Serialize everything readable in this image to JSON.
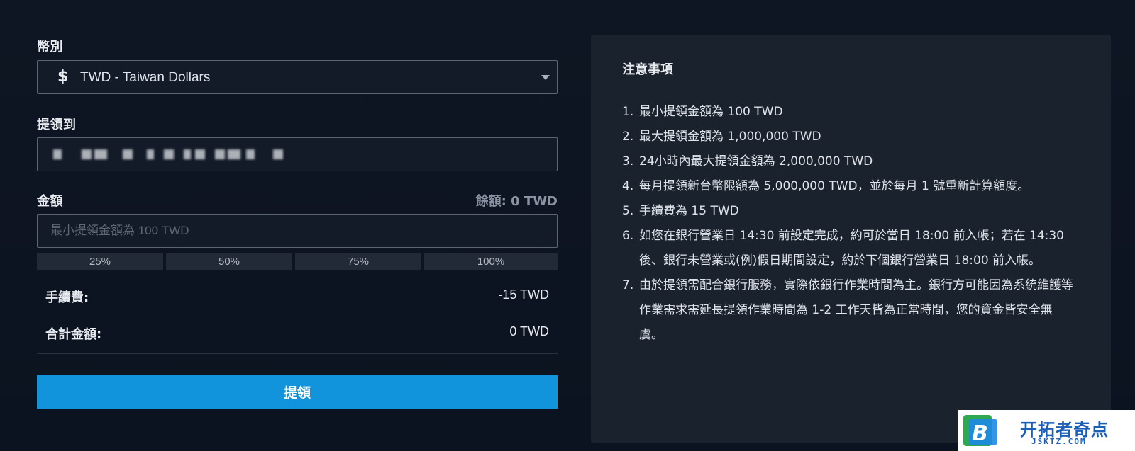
{
  "form": {
    "currency_label": "幣別",
    "currency_symbol": "$",
    "currency_value": "TWD - Taiwan Dollars",
    "withdraw_to_label": "提領到",
    "amount_label": "金額",
    "balance": "餘額: 0 TWD",
    "amount_placeholder": "最小提領金額為 100 TWD",
    "percent_buttons": [
      "25%",
      "50%",
      "75%",
      "100%"
    ],
    "fee_label": "手續費:",
    "fee_value": "-15 TWD",
    "total_label": "合計金額:",
    "total_value": "0 TWD",
    "submit_label": "提領"
  },
  "notes": {
    "title": "注意事項",
    "items": [
      {
        "num": "1.",
        "text": "最小提領金額為 100 TWD"
      },
      {
        "num": "2.",
        "text": "最大提領金額為 1,000,000 TWD"
      },
      {
        "num": "3.",
        "text": "24小時內最大提領金額為 2,000,000 TWD"
      },
      {
        "num": "4.",
        "text": "每月提領新台幣限額為 5,000,000 TWD，並於每月 1 號重新計算額度。"
      },
      {
        "num": "5.",
        "text": "手續費為 15 TWD"
      },
      {
        "num": "6.",
        "text": "如您在銀行營業日 14:30 前設定完成，約可於當日 18:00 前入帳；若在 14:30 後、銀行未營業或(例)假日期間設定，約於下個銀行營業日 18:00 前入帳。"
      },
      {
        "num": "7.",
        "text": "由於提領需配合銀行服務，實際依銀行作業時間為主。銀行方可能因為系統維護等作業需求需延長提領作業時間為 1-2 工作天皆為正常時間，您的資金皆安全無虞。"
      }
    ]
  },
  "watermark": {
    "text": "开拓者奇点",
    "sub": "JSKTZ.COM"
  },
  "colors": {
    "background": "#0f1623",
    "panel": "#1a222e",
    "accent": "#1194dc",
    "input_border": "#5d6570"
  }
}
